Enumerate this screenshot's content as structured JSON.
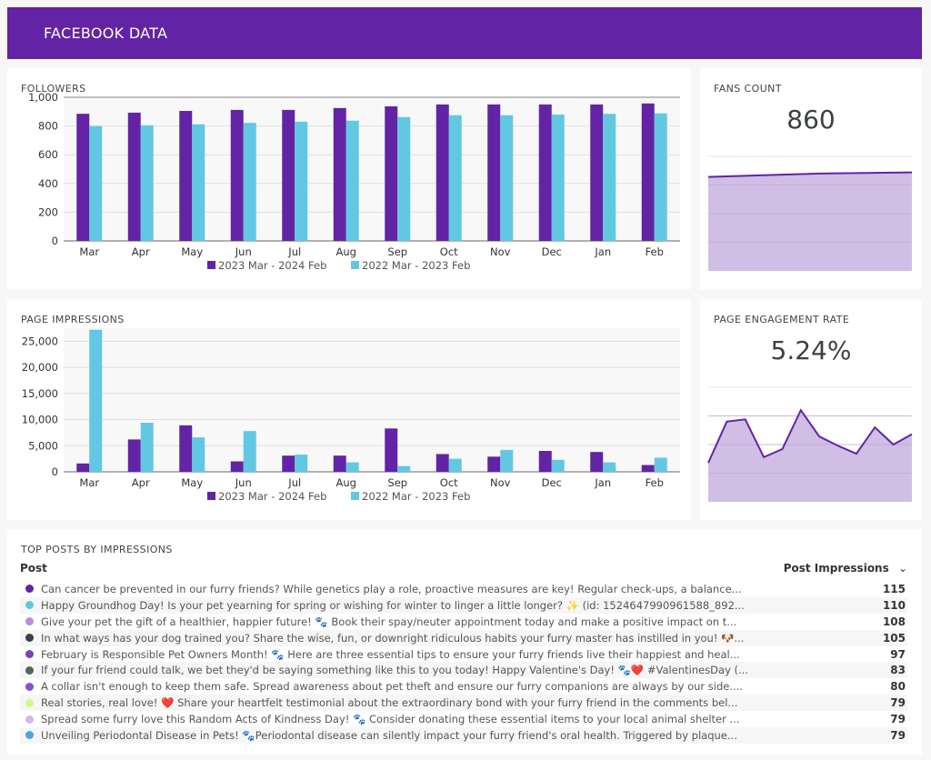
{
  "header": {
    "title": "FACEBOOK DATA"
  },
  "colors": {
    "primary": "#6224a4",
    "secondary": "#62c8e2",
    "area_fill": "#d0bee4",
    "header_bg": "#6224a4"
  },
  "chart_data": [
    {
      "id": "followers",
      "type": "bar",
      "title": "FOLLOWERS",
      "categories": [
        "Mar",
        "Apr",
        "May",
        "Jun",
        "Jul",
        "Aug",
        "Sep",
        "Oct",
        "Nov",
        "Dec",
        "Jan",
        "Feb"
      ],
      "series": [
        {
          "name": "2023 Mar - 2024 Feb",
          "values": [
            885,
            893,
            905,
            912,
            912,
            925,
            937,
            950,
            950,
            950,
            950,
            957
          ]
        },
        {
          "name": "2022 Mar - 2023 Feb",
          "values": [
            800,
            805,
            812,
            822,
            830,
            837,
            862,
            875,
            875,
            880,
            885,
            888
          ]
        }
      ],
      "yticks": [
        0,
        200,
        400,
        600,
        800,
        1000
      ],
      "ytick_labels": [
        "0",
        "200",
        "400",
        "600",
        "800",
        "1,000"
      ],
      "ylim": [
        0,
        1000
      ],
      "grid": true,
      "legend": "bottom"
    },
    {
      "id": "impressions",
      "type": "bar",
      "title": "PAGE IMPRESSIONS",
      "categories": [
        "Mar",
        "Apr",
        "May",
        "Jun",
        "Jul",
        "Aug",
        "Sep",
        "Oct",
        "Nov",
        "Dec",
        "Jan",
        "Feb"
      ],
      "series": [
        {
          "name": "2023 Mar - 2024 Feb",
          "values": [
            1600,
            6200,
            8900,
            2000,
            3100,
            3100,
            8300,
            3400,
            2900,
            4000,
            3800,
            1300
          ]
        },
        {
          "name": "2022 Mar - 2023 Feb",
          "values": [
            27200,
            9400,
            6600,
            7800,
            3300,
            1800,
            1100,
            2500,
            4200,
            2300,
            1800,
            2700
          ]
        }
      ],
      "yticks": [
        0,
        5000,
        10000,
        15000,
        20000,
        25000
      ],
      "ytick_labels": [
        "0",
        "5,000",
        "10,000",
        "15,000",
        "20,000",
        "25,000"
      ],
      "ylim": [
        0,
        27500
      ],
      "grid": true,
      "legend": "bottom"
    },
    {
      "id": "fans",
      "type": "area",
      "title": "FANS COUNT",
      "kpi": "860",
      "values": [
        820,
        825,
        830,
        835,
        840,
        845,
        850,
        852,
        854,
        856,
        858,
        860
      ],
      "ylim": [
        0,
        1000
      ]
    },
    {
      "id": "engagement",
      "type": "area",
      "title": "PAGE ENGAGEMENT RATE",
      "kpi": "5.24%",
      "values": [
        3.4,
        7.0,
        7.2,
        3.9,
        4.6,
        8.0,
        5.7,
        4.9,
        4.2,
        6.5,
        5.0,
        5.9
      ],
      "ylim": [
        0,
        10
      ]
    }
  ],
  "posts": {
    "title": "TOP POSTS BY IMPRESSIONS",
    "col_post": "Post",
    "col_impressions": "Post Impressions",
    "sort_icon": "chevron-down-icon",
    "rows": [
      {
        "color": "#6224a4",
        "text": "Can cancer be prevented in our furry friends? While genetics play a role, proactive measures are key! Regular check-ups, a balance...",
        "value": "115"
      },
      {
        "color": "#62c8e2",
        "text": "Happy Groundhog Day! Is your pet yearning for spring or wishing for winter to linger a little longer? ✨ (id: 1524647990961588_892...",
        "value": "110"
      },
      {
        "color": "#b48fdc",
        "text": "Give your pet the gift of a healthier, happier future! 🐾 Book their spay/neuter appointment today and make a positive impact on t...",
        "value": "108"
      },
      {
        "color": "#3a3f48",
        "text": "In what ways has your dog trained you? Share the wise, fun, or downright ridiculous habits your furry master has instilled in you! 🐶...",
        "value": "105"
      },
      {
        "color": "#7b3fc0",
        "text": "February is Responsible Pet Owners Month! 🐾 Here are three essential tips to ensure your furry friends live their happiest and heal...",
        "value": "97"
      },
      {
        "color": "#5f5f5f",
        "text": "If your fur friend could talk, we bet they'd be saying something like this to you today! Happy Valentine's Day! 🐾❤️ #ValentinesDay (...",
        "value": "83"
      },
      {
        "color": "#8d4fcf",
        "text": "A collar isn't enough to keep them safe. Spread awareness about pet theft and ensure our furry companions are always by our side....",
        "value": "80"
      },
      {
        "color": "#d6f58a",
        "text": "Real stories, real love! ❤️ Share your heartfelt testimonial about the extraordinary bond with your furry friend in the comments bel...",
        "value": "79"
      },
      {
        "color": "#d3b6e8",
        "text": "Spread some furry love this Random Acts of Kindness Day! 🐾 Consider donating these essential items to your local animal shelter ...",
        "value": "79"
      },
      {
        "color": "#4ea3db",
        "text": "Unveiling Periodontal Disease in Pets! 🐾Periodontal disease can silently impact your furry friend's oral health. Triggered by plaque...",
        "value": "79"
      }
    ]
  }
}
